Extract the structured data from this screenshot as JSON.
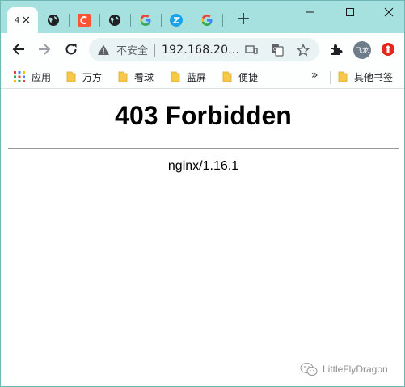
{
  "browser": {
    "tabs": [
      {
        "title": "4",
        "active": true,
        "icon": "page-icon"
      },
      {
        "icon": "globe-icon"
      },
      {
        "icon": "c-logo-icon",
        "color": "#ff5722"
      },
      {
        "icon": "globe-icon"
      },
      {
        "icon": "google-icon"
      },
      {
        "icon": "z-logo-icon",
        "color": "#1aa3e6"
      },
      {
        "icon": "google-icon"
      }
    ],
    "active_tab_close": "×",
    "new_tab_label": "+",
    "window_controls": [
      "minimize-icon",
      "maximize-icon",
      "close-icon"
    ]
  },
  "toolbar": {
    "security_label": "不安全",
    "url": "192.168.20...",
    "avatar_label": "飞龙",
    "icons": [
      "back-icon",
      "forward-icon",
      "reload-icon",
      "warning-icon",
      "cast-icon",
      "translate-icon",
      "star-icon",
      "extensions-icon",
      "avatar",
      "update-icon"
    ]
  },
  "bookmarks": {
    "items": [
      {
        "label": "应用",
        "icon": "apps-grid-icon"
      },
      {
        "label": "万方",
        "icon": "folder-icon"
      },
      {
        "label": "看球",
        "icon": "folder-icon"
      },
      {
        "label": "蓝屏",
        "icon": "folder-icon"
      },
      {
        "label": "便捷",
        "icon": "folder-icon"
      }
    ],
    "more": "»",
    "other": {
      "label": "其他书签",
      "icon": "folder-icon"
    }
  },
  "page": {
    "heading": "403 Forbidden",
    "server": "nginx/1.16.1"
  },
  "watermark": {
    "text": "LittleFlyDragon",
    "icon": "wechat-icon"
  },
  "colors": {
    "tabstrip": "#a6e1e0",
    "toolbar": "#fdfefe",
    "omnibox": "#e9f3f3"
  }
}
